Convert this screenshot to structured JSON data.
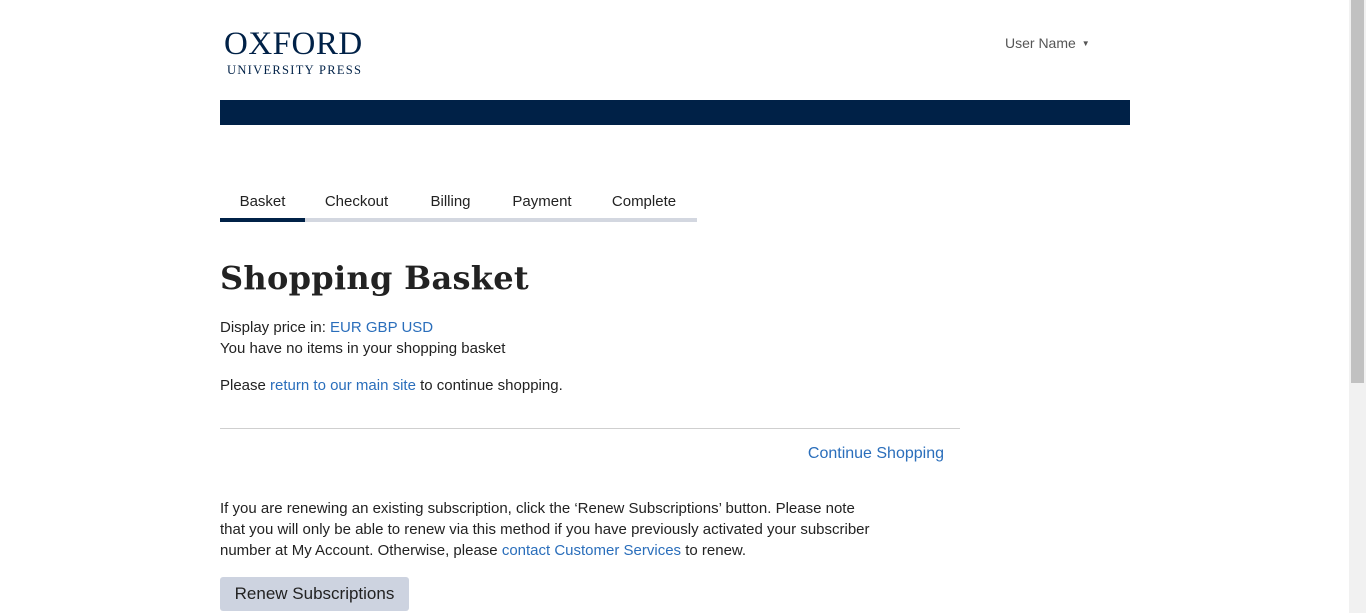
{
  "logo": {
    "main": "OXFORD",
    "sub": "UNIVERSITY PRESS"
  },
  "header": {
    "user_name": "User Name",
    "user_caret": "▼",
    "bar_color": "#002147"
  },
  "tabs": [
    {
      "label": "Basket",
      "active": true
    },
    {
      "label": "Checkout",
      "active": false
    },
    {
      "label": "Billing",
      "active": false
    },
    {
      "label": "Payment",
      "active": false
    },
    {
      "label": "Complete",
      "active": false
    }
  ],
  "main": {
    "title": "Shopping Basket",
    "display_price_label": "Display price in:",
    "currencies": [
      "EUR",
      "GBP",
      "USD"
    ],
    "empty_message": "You have no items in your shopping basket",
    "return_prefix": "Please",
    "return_link": "return to our main site",
    "return_suffix": "to continue shopping.",
    "continue_shopping": "Continue Shopping"
  },
  "renew": {
    "text": "If you are renewing an existing subscription, click the ‘Renew Subscriptions’ button. Please note that you will only be able to renew via this method if you have previously activated your subscriber number at My Account. Otherwise, please",
    "link": "contact Customer Services",
    "suffix": "to renew.",
    "button": "Renew Subscriptions"
  },
  "colors": {
    "navy": "#002147",
    "link": "#2a6ebb",
    "tab_track": "#d3d7e0",
    "button_bg": "#cdd3e0"
  }
}
